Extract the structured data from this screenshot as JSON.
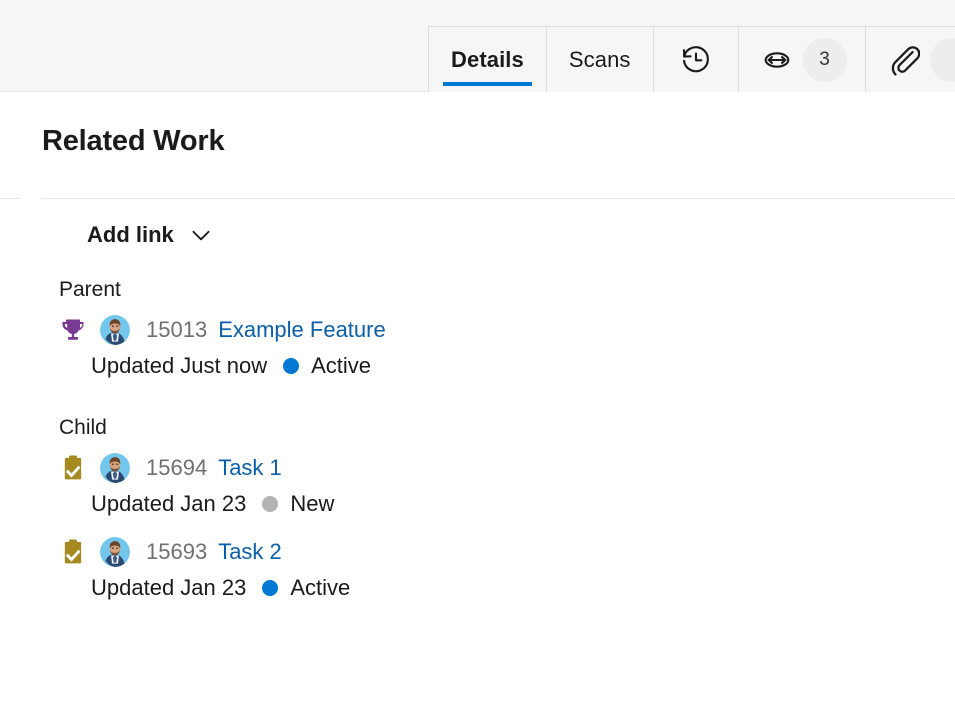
{
  "tabs": [
    {
      "label": "Details",
      "icon": "",
      "badge": "",
      "active": true,
      "name": "tab-details"
    },
    {
      "label": "Scans",
      "icon": "",
      "badge": "",
      "active": false,
      "name": "tab-scans"
    },
    {
      "label": "",
      "icon": "history-icon",
      "badge": "",
      "active": false,
      "name": "tab-history"
    },
    {
      "label": "",
      "icon": "link-icon",
      "badge": "3",
      "active": false,
      "name": "tab-links"
    },
    {
      "label": "",
      "icon": "paperclip-icon",
      "badge": "",
      "active": false,
      "name": "tab-attachments"
    }
  ],
  "header": {
    "title": "Related Work"
  },
  "toolbar": {
    "add_link_label": "Add link",
    "add_link_chevron": "chevron-down-icon"
  },
  "colors": {
    "accent": "#0078d4",
    "link": "#0a5eab",
    "feature": "#773b93",
    "task": "#a68a20",
    "state_active": "#0078d4",
    "state_new": "#b3b3b3",
    "id_text": "#707070"
  },
  "groups": [
    {
      "label": "Parent",
      "items": [
        {
          "type_icon": "trophy-icon",
          "type": "Feature",
          "avatar": "avatar-person-icon",
          "id": "15013",
          "title": "Example Feature",
          "updated": "Updated Just now",
          "state": "Active",
          "state_color": "#0078d4"
        }
      ]
    },
    {
      "label": "Child",
      "items": [
        {
          "type_icon": "task-clipboard-icon",
          "type": "Task",
          "avatar": "avatar-person-icon",
          "id": "15694",
          "title": "Task 1",
          "updated": "Updated Jan 23",
          "state": "New",
          "state_color": "#b3b3b3"
        },
        {
          "type_icon": "task-clipboard-icon",
          "type": "Task",
          "avatar": "avatar-person-icon",
          "id": "15693",
          "title": "Task 2",
          "updated": "Updated Jan 23",
          "state": "Active",
          "state_color": "#0078d4"
        }
      ]
    }
  ]
}
